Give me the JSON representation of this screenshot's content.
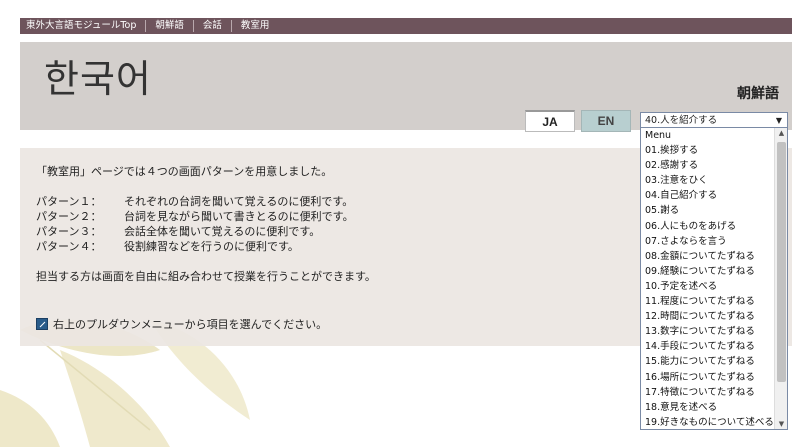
{
  "nav": {
    "items": [
      "東外大言語モジュールTop",
      "朝鮮語",
      "会話",
      "教室用"
    ]
  },
  "header": {
    "title": "한국어",
    "language_label": "朝鮮語"
  },
  "lang_buttons": {
    "ja": "JA",
    "en": "EN"
  },
  "select": {
    "selected": "40.人を紹介する",
    "arrow": "▼",
    "options": [
      "Menu",
      "01.挨拶する",
      "02.感謝する",
      "03.注意をひく",
      "04.自己紹介する",
      "05.謝る",
      "06.人にものをあげる",
      "07.さよならを言う",
      "08.金額についてたずねる",
      "09.経験についてたずねる",
      "10.予定を述べる",
      "11.程度についてたずねる",
      "12.時間についてたずねる",
      "13.数字についてたずねる",
      "14.手段についてたずねる",
      "15.能力についてたずねる",
      "16.場所についてたずねる",
      "17.特徴についてたずねる",
      "18.意見を述べる",
      "19.好きなものについて述べる"
    ]
  },
  "content": {
    "intro": "「教室用」ページでは４つの画面パターンを用意しました。",
    "patterns": [
      {
        "label": "パターン１：",
        "text": "それぞれの台詞を聞いて覚えるのに便利です。"
      },
      {
        "label": "パターン２：",
        "text": "台詞を見ながら聞いて書きとるのに便利です。"
      },
      {
        "label": "パターン３：",
        "text": "会話全体を聞いて覚えるのに便利です。"
      },
      {
        "label": "パターン４：",
        "text": "役割練習などを行うのに便利です。"
      }
    ],
    "note": "担当する方は画面を自由に組み合わせて授業を行うことができます。",
    "link_text": "右上のプルダウンメニューから項目を選んでください。"
  },
  "colors": {
    "nav_bg": "#6e545c",
    "header_bg": "#d3cfcc",
    "en_button_bg": "#b8cfd0",
    "link_icon": "#2a5c8a"
  }
}
